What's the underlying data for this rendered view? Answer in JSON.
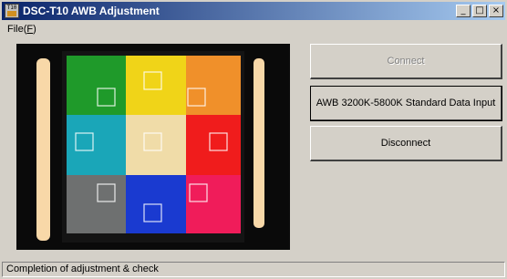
{
  "window": {
    "title": "DSC-T10 AWB Adjustment",
    "icon_label": "T10",
    "controls": {
      "minimize": "_",
      "maximize": "□",
      "close": "×"
    }
  },
  "menu": {
    "file_label": "File",
    "file_accel": "F"
  },
  "preview": {
    "description": "camera-preview",
    "patches": [
      {
        "color": "#1f9a2a"
      },
      {
        "color": "#f0d418"
      },
      {
        "color": "#f0902a"
      },
      {
        "color": "#1aa6b8"
      },
      {
        "color": "#f0dca8"
      },
      {
        "color": "#f01c1c"
      },
      {
        "color": "#6e7070"
      },
      {
        "color": "#1a3ad0"
      },
      {
        "color": "#f01c5a"
      }
    ]
  },
  "buttons": {
    "connect": "Connect",
    "awb_input": "AWB 3200K-5800K Standard Data Input",
    "disconnect": "Disconnect"
  },
  "status": {
    "text": "Completion of adjustment & check"
  }
}
